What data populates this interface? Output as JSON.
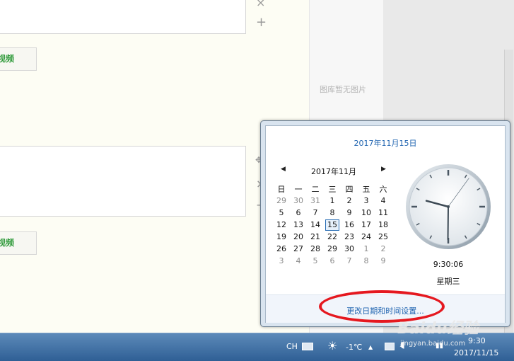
{
  "editor": {
    "video_button_1": "视频",
    "video_button_2": "视频",
    "gallery_empty": "图库暂无图片"
  },
  "calendar_popup": {
    "long_date": "2017年11月15日",
    "month_label": "2017年11月",
    "weekdays": [
      "日",
      "一",
      "二",
      "三",
      "四",
      "五",
      "六"
    ],
    "weeks": [
      [
        "29",
        "30",
        "31",
        "1",
        "2",
        "3",
        "4"
      ],
      [
        "5",
        "6",
        "7",
        "8",
        "9",
        "10",
        "11"
      ],
      [
        "12",
        "13",
        "14",
        "15",
        "16",
        "17",
        "18"
      ],
      [
        "19",
        "20",
        "21",
        "22",
        "23",
        "24",
        "25"
      ],
      [
        "26",
        "27",
        "28",
        "29",
        "30",
        "1",
        "2"
      ],
      [
        "3",
        "4",
        "5",
        "6",
        "7",
        "8",
        "9"
      ]
    ],
    "today": "15",
    "time": "9:30:06",
    "weekday_label": "星期三",
    "change_link": "更改日期和时间设置...",
    "clock": {
      "hour": 9,
      "minute": 30,
      "second": 6
    }
  },
  "taskbar": {
    "language": "CH",
    "temperature": "-1℃",
    "time": "9:30",
    "date": "2017/11/15"
  },
  "watermark": {
    "brand": "Baidu经验",
    "url": "jingyan.baidu.com"
  },
  "colors": {
    "link": "#1f64b0",
    "annotation": "#e5181f",
    "taskbar": "#2f5f95"
  }
}
